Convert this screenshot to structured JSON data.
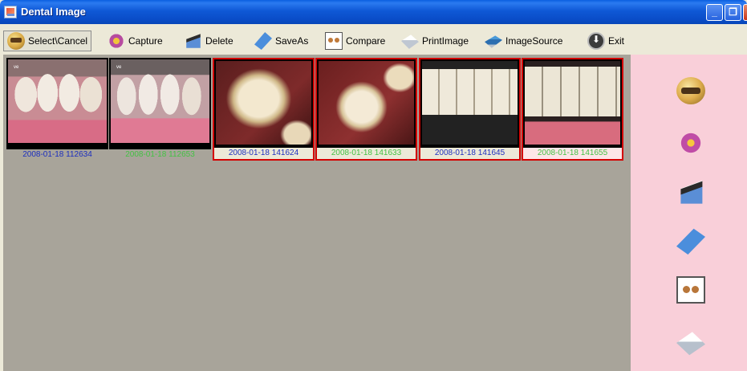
{
  "window": {
    "title": "Dental Image",
    "controls": {
      "minimize": "_",
      "maximize": "❐",
      "close": "✕"
    }
  },
  "toolbar": {
    "buttons": [
      {
        "label": "Select\\Cancel",
        "icon": "film-reel-icon"
      },
      {
        "label": "Capture",
        "icon": "capture-icon"
      },
      {
        "label": "Delete",
        "icon": "clapper-icon"
      },
      {
        "label": "SaveAs",
        "icon": "card-icon"
      },
      {
        "label": "Compare",
        "icon": "compare-icon"
      },
      {
        "label": "PrintImage",
        "icon": "printer-icon"
      },
      {
        "label": "ImageSource",
        "icon": "drive-icon"
      },
      {
        "label": "Exit",
        "icon": "exit-icon"
      }
    ]
  },
  "gallery": {
    "thumbnails": [
      {
        "caption": "2008-01-18 112634",
        "selected": false,
        "caption_color": "blue"
      },
      {
        "caption": "2008-01-18 112653",
        "selected": false,
        "caption_color": "green"
      },
      {
        "caption": "2008-01-18 141624",
        "selected": true,
        "caption_color": "blue"
      },
      {
        "caption": "2008-01-18 141633",
        "selected": true,
        "caption_color": "green"
      },
      {
        "caption": "2008-01-18 141645",
        "selected": true,
        "caption_color": "blue"
      },
      {
        "caption": "2008-01-18 141655",
        "selected": true,
        "caption_color": "green"
      }
    ]
  },
  "sidepanel": {
    "icons": [
      "film-reel-icon",
      "capture-icon",
      "clapper-icon",
      "card-icon",
      "compare-icon",
      "printer-icon"
    ]
  },
  "colors": {
    "titlebar": "#0a4dc8",
    "gallery_bg": "#a8a49a",
    "sidepanel_bg": "#f9cfd9",
    "selection_border": "#d40000",
    "caption_blue": "#1d2fbf",
    "caption_green": "#44c244"
  }
}
